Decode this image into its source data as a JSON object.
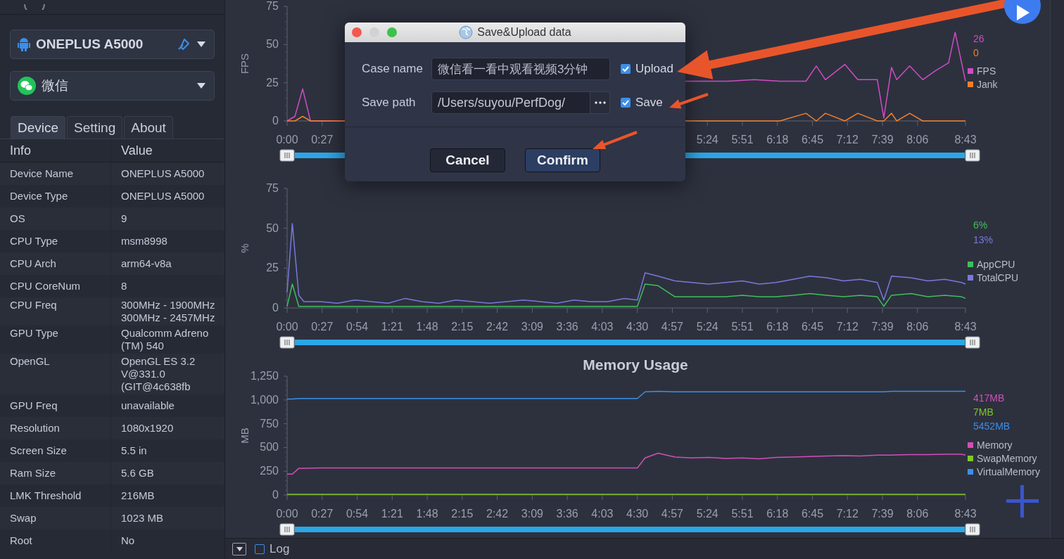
{
  "sidebar": {
    "device_select": {
      "value": "ONEPLUS A5000"
    },
    "app_select": {
      "value": "微信"
    },
    "tabs": [
      {
        "label": "Device",
        "selected": true
      },
      {
        "label": "Setting",
        "selected": false
      },
      {
        "label": "About",
        "selected": false
      }
    ],
    "info_table": {
      "columns": [
        "Info",
        "Value"
      ],
      "rows": [
        {
          "label": "Device Name",
          "lines": [
            "ONEPLUS A5000"
          ]
        },
        {
          "label": "Device Type",
          "lines": [
            "ONEPLUS A5000"
          ]
        },
        {
          "label": "OS",
          "lines": [
            "9"
          ]
        },
        {
          "label": "CPU Type",
          "lines": [
            "msm8998"
          ]
        },
        {
          "label": "CPU Arch",
          "lines": [
            "arm64-v8a"
          ]
        },
        {
          "label": "CPU CoreNum",
          "lines": [
            "8"
          ]
        },
        {
          "label": "CPU Freq",
          "lines": [
            "300MHz - 1900MHz",
            "300MHz - 2457MHz"
          ]
        },
        {
          "label": "GPU Type",
          "lines": [
            "Qualcomm Adreno",
            "(TM) 540"
          ]
        },
        {
          "label": "OpenGL",
          "lines": [
            "OpenGL ES 3.2",
            "V@331.0",
            "(GIT@4c638fb"
          ]
        },
        {
          "label": "GPU Freq",
          "lines": [
            "unavailable"
          ]
        },
        {
          "label": "Resolution",
          "lines": [
            "1080x1920"
          ]
        },
        {
          "label": "Screen Size",
          "lines": [
            "5.5 in"
          ]
        },
        {
          "label": "Ram Size",
          "lines": [
            "5.6 GB"
          ]
        },
        {
          "label": "LMK Threshold",
          "lines": [
            "216MB"
          ]
        },
        {
          "label": "Swap",
          "lines": [
            "1023 MB"
          ]
        },
        {
          "label": "Root",
          "lines": [
            "No"
          ]
        }
      ]
    }
  },
  "charts": [
    {
      "readouts": [
        {
          "text": "26",
          "color": "#d04cc4"
        },
        {
          "text": "0",
          "color": "#f07f2e"
        }
      ],
      "slider": {
        "level": 1
      },
      "chart_data": {
        "type": "line",
        "legend": "right",
        "ylabel": "FPS",
        "x": [
          0,
          6,
          12,
          18,
          30,
          44,
          307,
          320,
          340,
          360,
          380,
          400,
          408,
          415,
          430,
          440,
          455,
          460,
          466,
          470,
          480,
          490,
          500,
          510,
          515,
          523
        ],
        "series": [
          {
            "name": "FPS",
            "color": "#d04cc4",
            "values": [
              0,
              3,
              21,
              0,
              0,
              0,
              26,
              26,
              26,
              27,
              26,
              26,
              36,
              27,
              37,
              27,
              27,
              2,
              35,
              27,
              36,
              27,
              33,
              38,
              58,
              26
            ]
          },
          {
            "name": "Jank",
            "color": "#f07f2e",
            "values": [
              0,
              0,
              3,
              0,
              0,
              0,
              0,
              0,
              0,
              0,
              0,
              5,
              0,
              5,
              0,
              5,
              0,
              0,
              5,
              0,
              5,
              0,
              0,
              0,
              0,
              0
            ]
          }
        ],
        "xlim": [
          0,
          523
        ],
        "ylim": [
          0,
          75
        ],
        "yticks": [
          0,
          25,
          50,
          75
        ],
        "xticks": [
          {
            "value": 0,
            "label": "0:00"
          },
          {
            "value": 27,
            "label": "0:27"
          },
          {
            "value": 324,
            "label": "5:24"
          },
          {
            "value": 351,
            "label": "5:51"
          },
          {
            "value": 378,
            "label": "6:18"
          },
          {
            "value": 405,
            "label": "6:45"
          },
          {
            "value": 432,
            "label": "7:12"
          },
          {
            "value": 459,
            "label": "7:39"
          },
          {
            "value": 486,
            "label": "8:06"
          },
          {
            "value": 523,
            "label": "8:43"
          }
        ]
      }
    },
    {
      "readouts": [
        {
          "text": "6%",
          "color": "#3fbf5a"
        },
        {
          "text": "13%",
          "color": "#7a78dc"
        }
      ],
      "slider": {
        "level": 1
      },
      "chart_data": {
        "type": "line",
        "legend": "right",
        "ylabel": "%",
        "x": [
          0,
          4,
          9,
          13,
          26,
          39,
          52,
          65,
          78,
          91,
          104,
          117,
          130,
          143,
          156,
          169,
          182,
          195,
          208,
          221,
          234,
          247,
          260,
          270,
          276,
          286,
          299,
          312,
          325,
          338,
          351,
          364,
          377,
          390,
          403,
          416,
          429,
          442,
          455,
          460,
          466,
          481,
          494,
          507,
          520,
          523
        ],
        "series": [
          {
            "name": "AppCPU",
            "color": "#3fbf5a",
            "values": [
              1,
              15,
              1,
              1,
              1,
              1,
              1,
              1,
              1,
              1,
              1,
              1,
              1,
              1,
              1,
              1,
              1,
              1,
              1,
              1,
              1,
              1,
              1,
              1,
              15,
              14,
              7,
              7,
              7,
              7,
              8,
              7,
              7,
              8,
              9,
              8,
              7,
              8,
              7,
              1,
              8,
              9,
              7,
              8,
              7,
              6
            ]
          },
          {
            "name": "TotalCPU",
            "color": "#7a78dc",
            "values": [
              10,
              53,
              8,
              4,
              4,
              3,
              5,
              4,
              3,
              6,
              4,
              3,
              5,
              4,
              3,
              4,
              5,
              4,
              3,
              5,
              4,
              4,
              6,
              5,
              22,
              20,
              17,
              16,
              15,
              16,
              17,
              15,
              16,
              18,
              20,
              19,
              17,
              18,
              16,
              5,
              20,
              19,
              17,
              18,
              16,
              15
            ]
          }
        ],
        "xlim": [
          0,
          523
        ],
        "ylim": [
          0,
          75
        ],
        "yticks": [
          0,
          25,
          50,
          75
        ],
        "xticks": [
          {
            "value": 0,
            "label": "0:00"
          },
          {
            "value": 27,
            "label": "0:27"
          },
          {
            "value": 54,
            "label": "0:54"
          },
          {
            "value": 81,
            "label": "1:21"
          },
          {
            "value": 108,
            "label": "1:48"
          },
          {
            "value": 135,
            "label": "2:15"
          },
          {
            "value": 162,
            "label": "2:42"
          },
          {
            "value": 189,
            "label": "3:09"
          },
          {
            "value": 216,
            "label": "3:36"
          },
          {
            "value": 243,
            "label": "4:03"
          },
          {
            "value": 270,
            "label": "4:30"
          },
          {
            "value": 297,
            "label": "4:57"
          },
          {
            "value": 324,
            "label": "5:24"
          },
          {
            "value": 351,
            "label": "5:51"
          },
          {
            "value": 378,
            "label": "6:18"
          },
          {
            "value": 405,
            "label": "6:45"
          },
          {
            "value": 432,
            "label": "7:12"
          },
          {
            "value": 459,
            "label": "7:39"
          },
          {
            "value": 486,
            "label": "8:06"
          },
          {
            "value": 523,
            "label": "8:43"
          }
        ]
      }
    },
    {
      "readouts": [
        {
          "text": "417MB",
          "color": "#d24fb8"
        },
        {
          "text": "7MB",
          "color": "#80c824"
        },
        {
          "text": "5452MB",
          "color": "#3c8fe8"
        }
      ],
      "slider": {
        "level": 1
      },
      "chart_data": {
        "type": "line",
        "legend": "right",
        "title": "Memory Usage",
        "ylabel": "MB",
        "x": [
          0,
          4,
          9,
          13,
          26,
          39,
          52,
          65,
          78,
          91,
          104,
          117,
          130,
          143,
          156,
          169,
          182,
          195,
          208,
          221,
          234,
          247,
          260,
          270,
          276,
          286,
          299,
          312,
          325,
          338,
          351,
          364,
          377,
          390,
          403,
          416,
          429,
          442,
          455,
          460,
          466,
          481,
          494,
          507,
          520,
          523
        ],
        "series": [
          {
            "name": "Memory",
            "color": "#d24fb8",
            "values": [
              220,
              220,
              280,
              280,
              285,
              285,
              285,
              285,
              285,
              285,
              285,
              285,
              285,
              285,
              285,
              285,
              285,
              285,
              285,
              285,
              285,
              285,
              285,
              285,
              390,
              440,
              400,
              390,
              395,
              385,
              390,
              380,
              395,
              400,
              405,
              410,
              415,
              410,
              420,
              420,
              420,
              425,
              425,
              430,
              430,
              420
            ]
          },
          {
            "name": "SwapMemory",
            "color": "#80c824",
            "values": [
              7,
              7,
              7,
              7,
              7,
              7,
              7,
              7,
              7,
              7,
              7,
              7,
              7,
              7,
              7,
              7,
              7,
              7,
              7,
              7,
              7,
              7,
              7,
              7,
              7,
              7,
              7,
              7,
              7,
              7,
              7,
              7,
              7,
              7,
              7,
              7,
              7,
              7,
              7,
              7,
              7,
              7,
              7,
              7,
              7,
              7
            ]
          },
          {
            "name": "VirtualMemory",
            "color": "#3c8fe8",
            "values": [
              1010,
              1010,
              1015,
              1015,
              1015,
              1015,
              1015,
              1015,
              1015,
              1015,
              1015,
              1015,
              1015,
              1015,
              1015,
              1015,
              1015,
              1015,
              1015,
              1015,
              1015,
              1015,
              1015,
              1015,
              1085,
              1090,
              1085,
              1085,
              1085,
              1085,
              1085,
              1085,
              1085,
              1085,
              1085,
              1085,
              1085,
              1085,
              1085,
              1085,
              1090,
              1090,
              1090,
              1090,
              1090,
              1090
            ]
          }
        ],
        "xlim": [
          0,
          523
        ],
        "ylim": [
          0,
          1250
        ],
        "yticks": [
          0,
          250,
          500,
          750,
          {
            "value": 1000,
            "label": "1,000"
          },
          {
            "value": 1250,
            "label": "1,250"
          }
        ],
        "xticks": [
          {
            "value": 0,
            "label": "0:00"
          },
          {
            "value": 27,
            "label": "0:27"
          },
          {
            "value": 54,
            "label": "0:54"
          },
          {
            "value": 81,
            "label": "1:21"
          },
          {
            "value": 108,
            "label": "1:48"
          },
          {
            "value": 135,
            "label": "2:15"
          },
          {
            "value": 162,
            "label": "2:42"
          },
          {
            "value": 189,
            "label": "3:09"
          },
          {
            "value": 216,
            "label": "3:36"
          },
          {
            "value": 243,
            "label": "4:03"
          },
          {
            "value": 270,
            "label": "4:30"
          },
          {
            "value": 297,
            "label": "4:57"
          },
          {
            "value": 324,
            "label": "5:24"
          },
          {
            "value": 351,
            "label": "5:51"
          },
          {
            "value": 378,
            "label": "6:18"
          },
          {
            "value": 405,
            "label": "6:45"
          },
          {
            "value": 432,
            "label": "7:12"
          },
          {
            "value": 459,
            "label": "7:39"
          },
          {
            "value": 486,
            "label": "8:06"
          },
          {
            "value": 523,
            "label": "8:43"
          }
        ]
      }
    }
  ],
  "dialog": {
    "title": "Save&Upload data",
    "fields": [
      {
        "kind": "text",
        "label": "Case name",
        "value": "微信看一看中观看视频3分钟",
        "option": {
          "label": "Upload",
          "checked": true
        }
      },
      {
        "kind": "path",
        "label": "Save path",
        "value": "/Users/suyou/PerfDog/",
        "option": {
          "label": "Save",
          "checked": true
        }
      }
    ],
    "buttons": [
      {
        "label": "Cancel",
        "kind": "default"
      },
      {
        "label": "Confirm",
        "kind": "primary"
      }
    ]
  },
  "bottom_bar": {
    "log": {
      "label": "Log",
      "checked": false
    }
  }
}
